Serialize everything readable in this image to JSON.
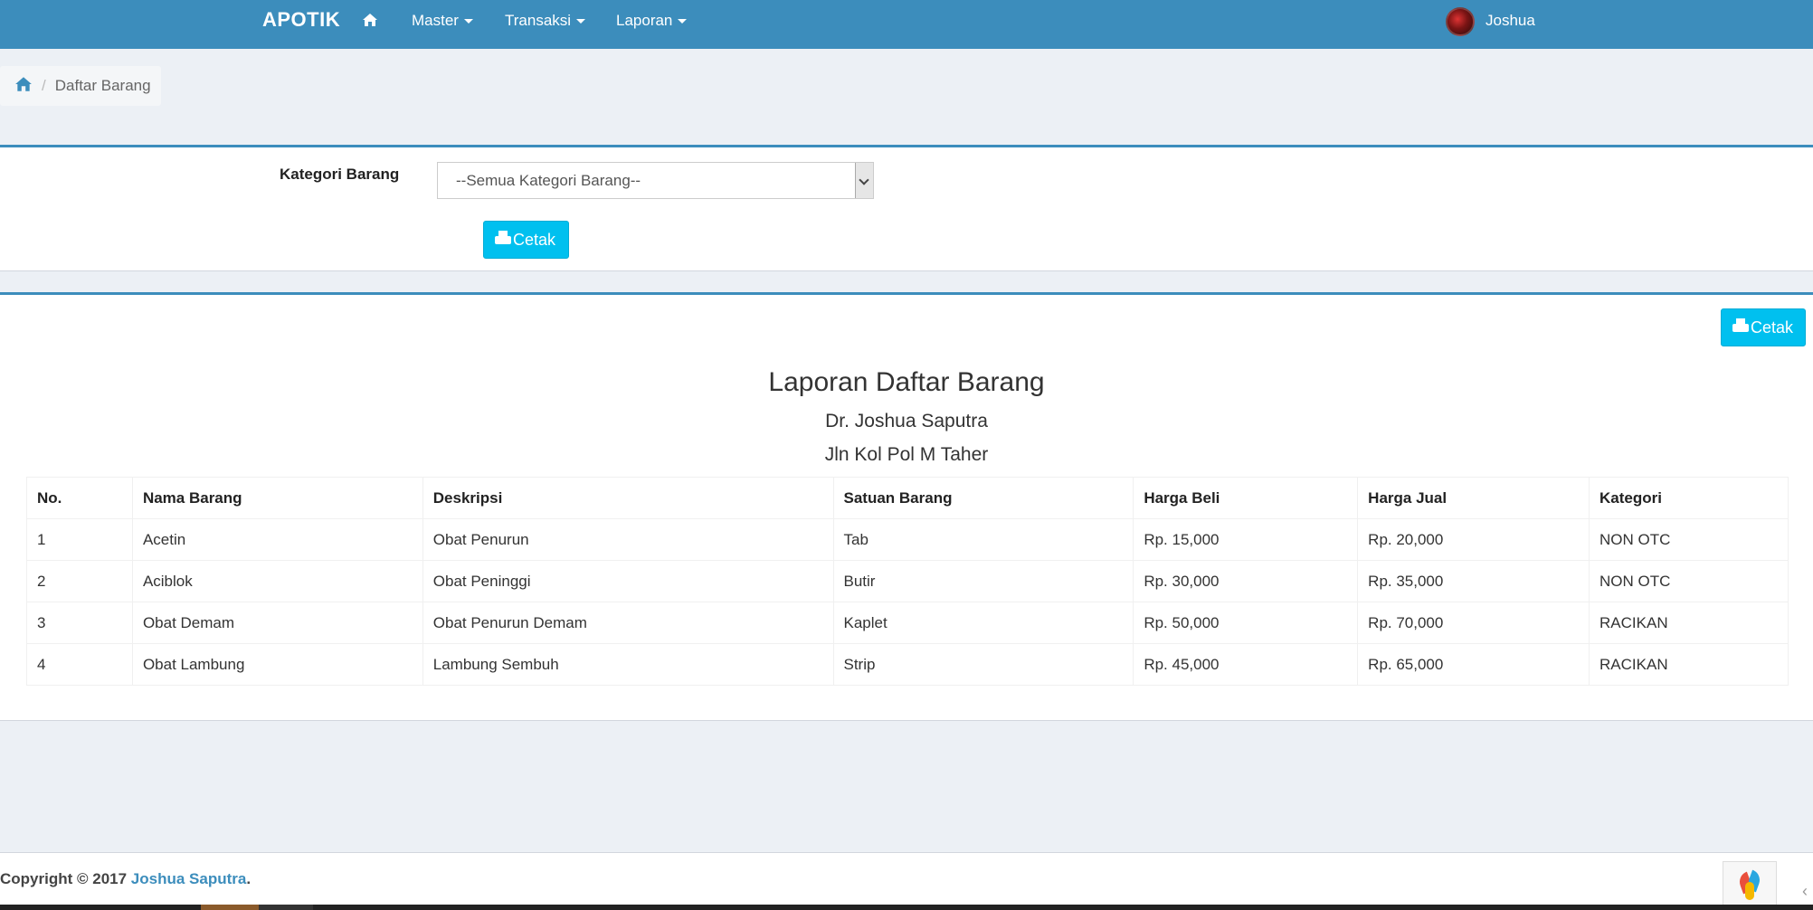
{
  "navbar": {
    "brand": "APOTIK",
    "items": [
      {
        "label": "Master"
      },
      {
        "label": "Transaksi"
      },
      {
        "label": "Laporan"
      }
    ],
    "user": "Joshua"
  },
  "breadcrumb": {
    "current": "Daftar Barang"
  },
  "filter": {
    "label": "Kategori Barang",
    "select_value": "--Semua Kategori Barang--",
    "button_label": "Cetak"
  },
  "report": {
    "button_label": "Cetak",
    "title": "Laporan Daftar Barang",
    "subtitle": "Dr. Joshua Saputra",
    "address": "Jln Kol Pol M Taher",
    "columns": [
      "No.",
      "Nama Barang",
      "Deskripsi",
      "Satuan Barang",
      "Harga Beli",
      "Harga Jual",
      "Kategori"
    ],
    "rows": [
      [
        "1",
        "Acetin",
        "Obat Penurun",
        "Tab",
        "Rp. 15,000",
        "Rp. 20,000",
        "NON OTC"
      ],
      [
        "2",
        "Aciblok",
        "Obat Peninggi",
        "Butir",
        "Rp. 30,000",
        "Rp. 35,000",
        "NON OTC"
      ],
      [
        "3",
        "Obat Demam",
        "Obat Penurun Demam",
        "Kaplet",
        "Rp. 50,000",
        "Rp. 70,000",
        "RACIKAN"
      ],
      [
        "4",
        "Obat Lambung",
        "Lambung Sembuh",
        "Strip",
        "Rp. 45,000",
        "Rp. 65,000",
        "RACIKAN"
      ]
    ]
  },
  "footer": {
    "prefix": "Copyright © 2017 ",
    "author": "Joshua Saputra",
    "suffix": "."
  },
  "colors": {
    "primary": "#3c8dbc",
    "info": "#00c0ef",
    "background": "#ecf0f5"
  }
}
